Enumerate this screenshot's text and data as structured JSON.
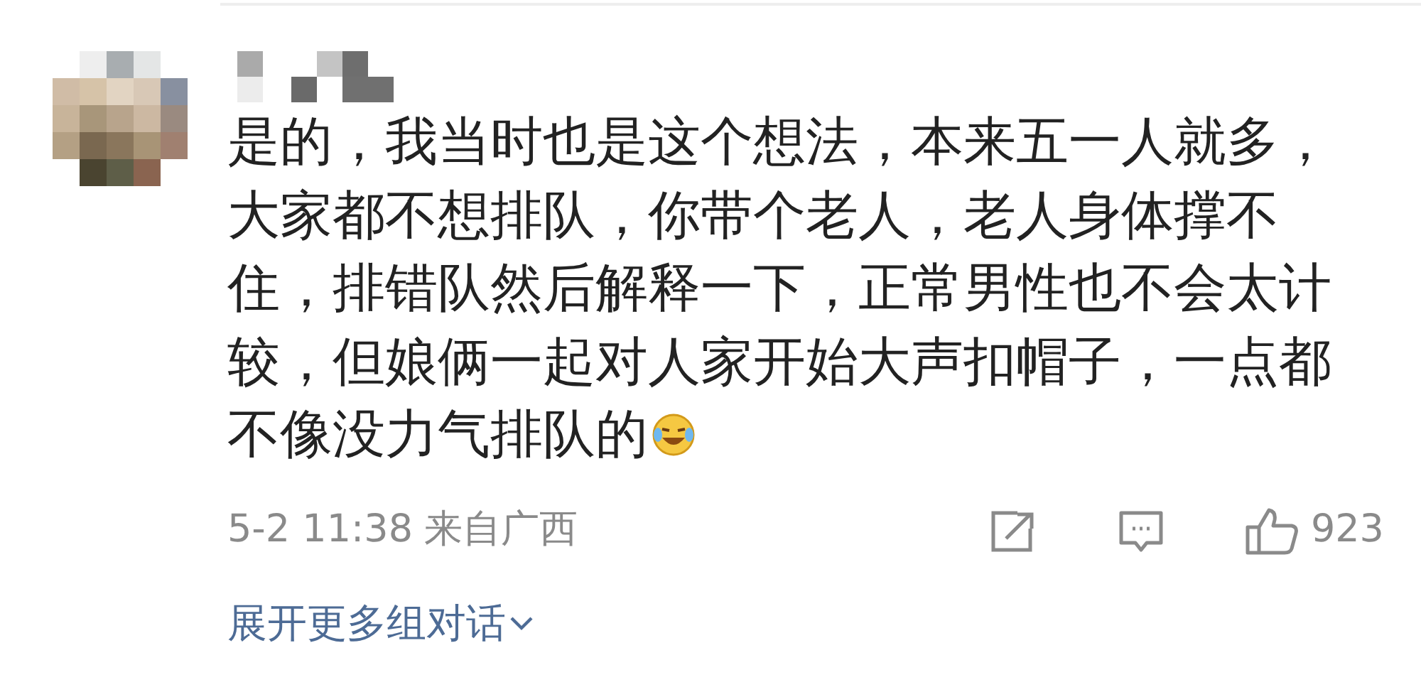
{
  "comment": {
    "text": "是的，我当时也是这个想法，本来五一人就多，大家都不想排队，你带个老人，老人身体撑不住，排错队然后解释一下，正常男性也不会太计较，但娘俩一起对人家开始大声扣帽子，一点都不像没力气排队的",
    "time": "5-2 11:38",
    "location": "来自广西",
    "likes": "923",
    "expand_link": "展开更多组对话"
  }
}
